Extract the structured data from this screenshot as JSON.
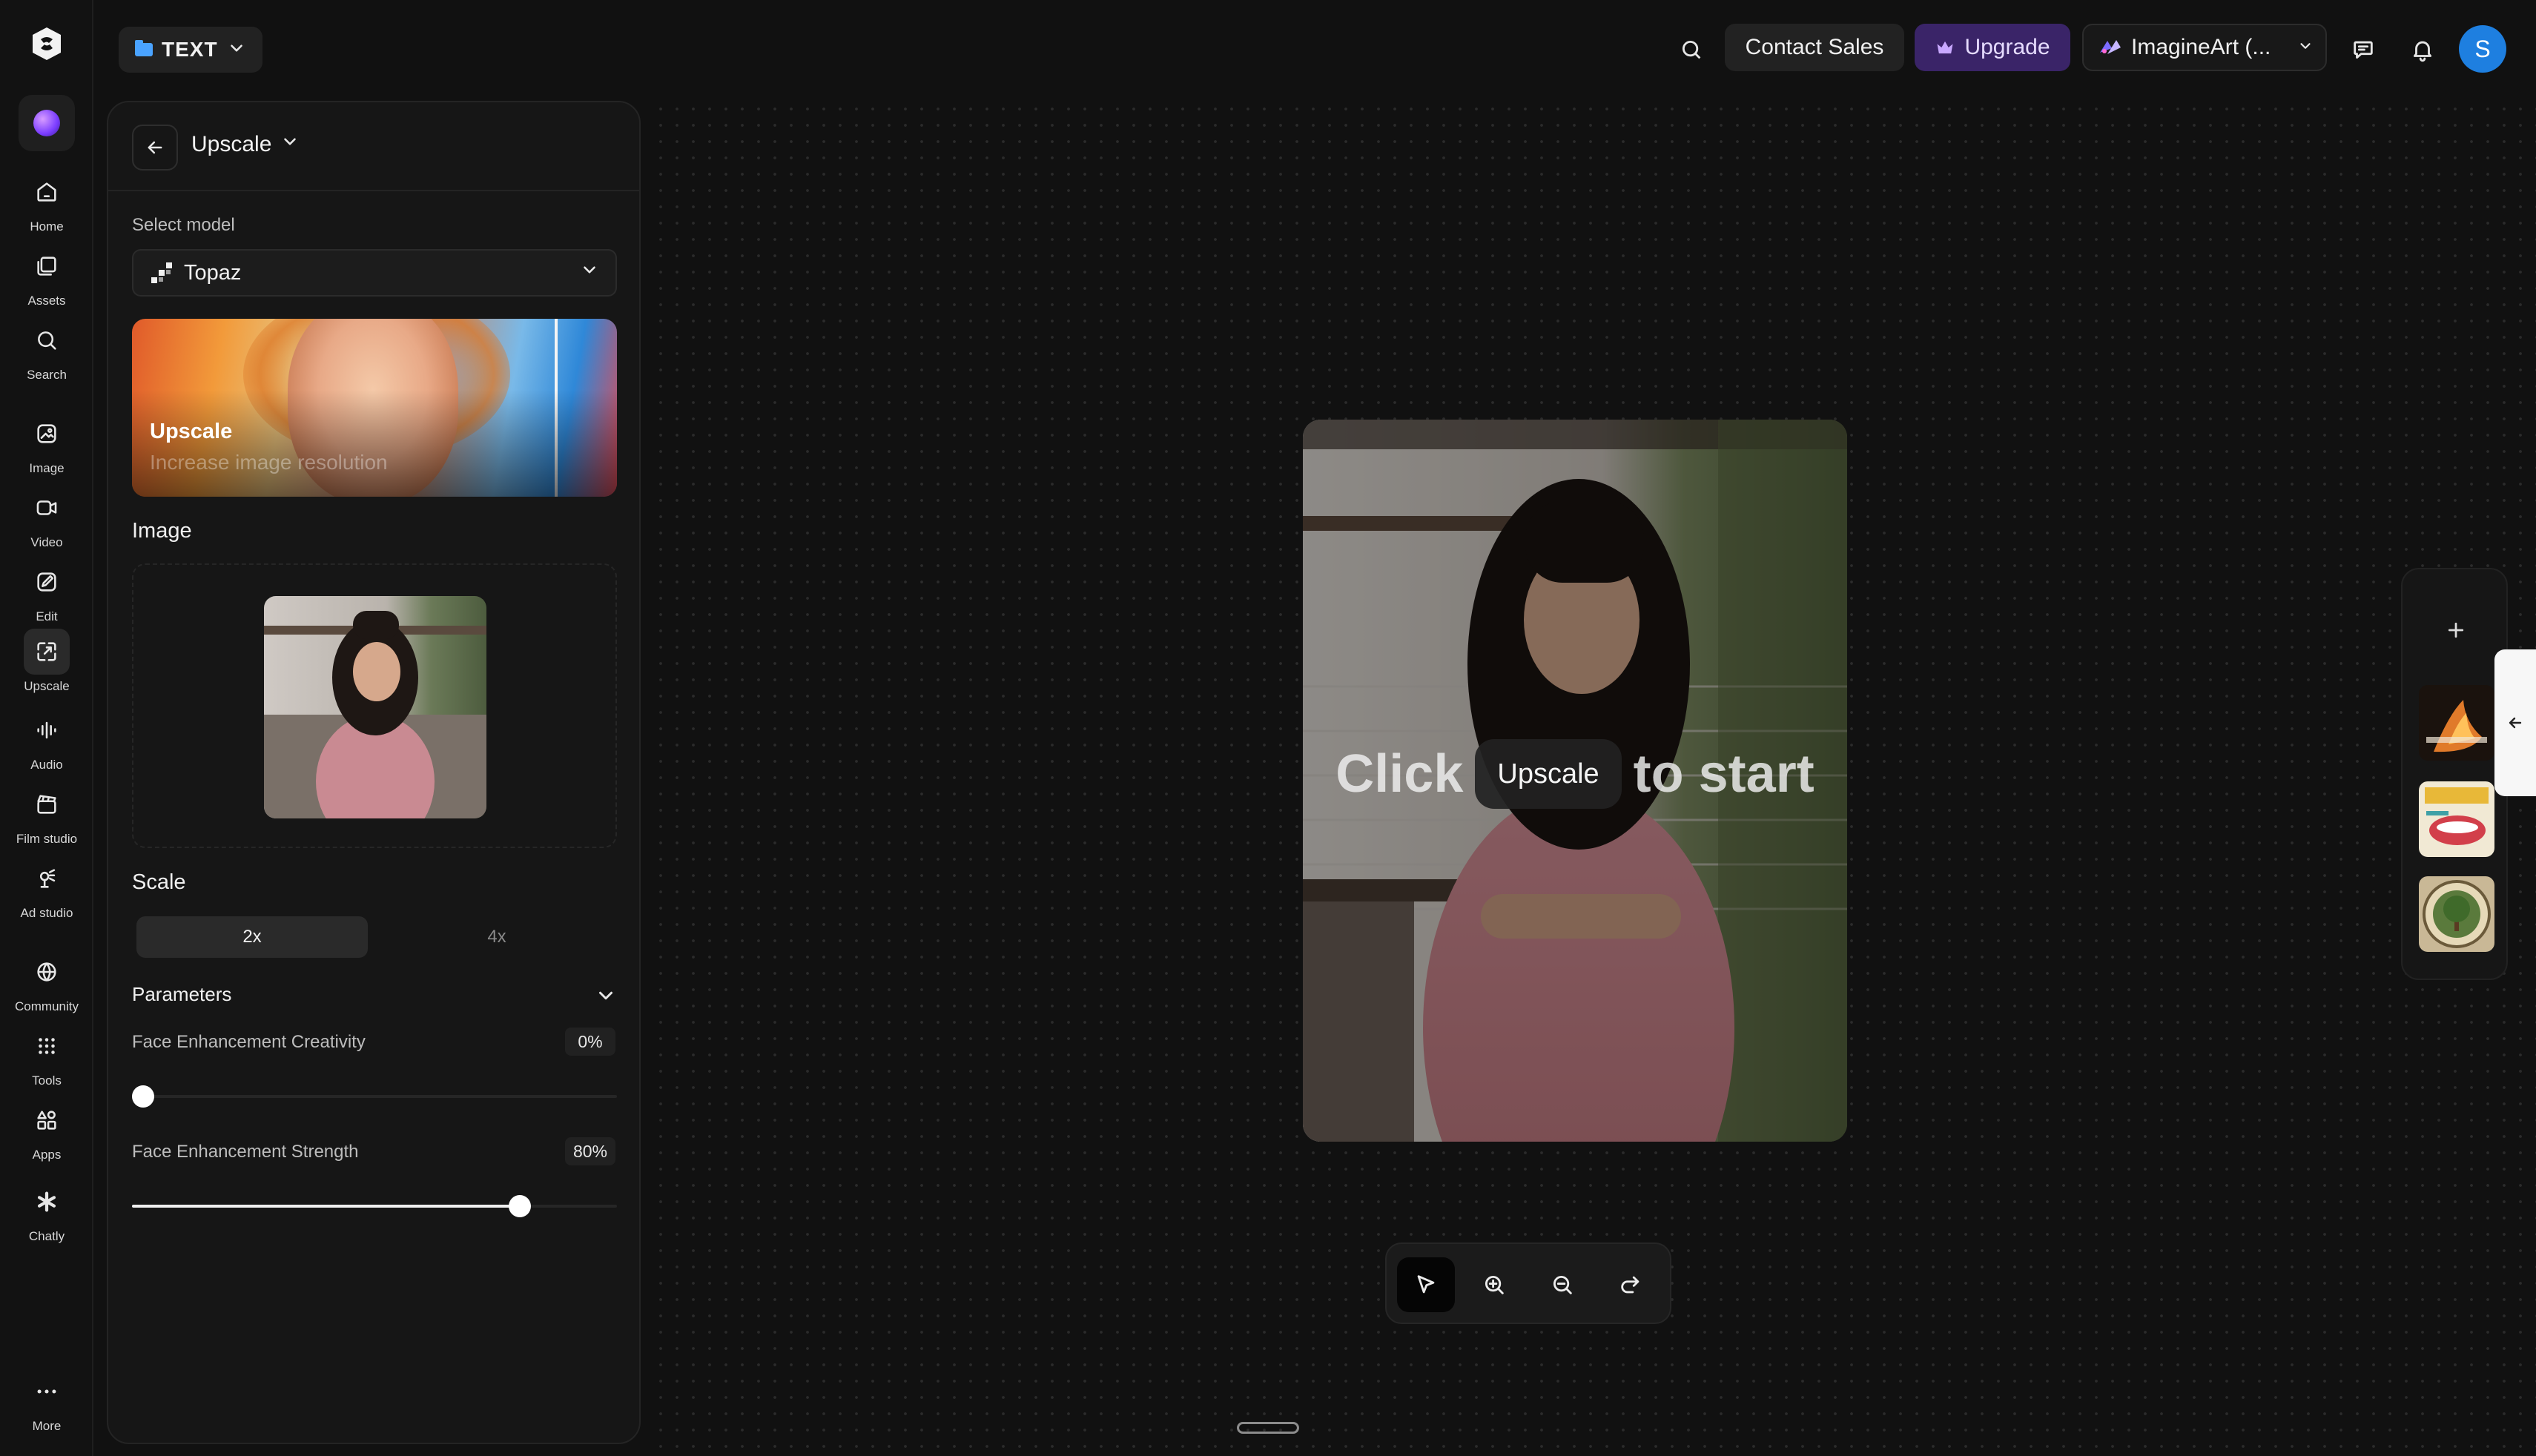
{
  "app": {
    "brand_color": "#ffffff",
    "accent": "#1e7fe0",
    "upgrade_color": "#3a2468"
  },
  "rail": {
    "items": [
      {
        "label": "Home",
        "icon": "home-icon"
      },
      {
        "label": "Assets",
        "icon": "assets-icon"
      },
      {
        "label": "Search",
        "icon": "search-icon"
      },
      {
        "label": "Image",
        "icon": "image-icon"
      },
      {
        "label": "Video",
        "icon": "video-icon"
      },
      {
        "label": "Edit",
        "icon": "edit-icon"
      },
      {
        "label": "Upscale",
        "icon": "upscale-icon",
        "active": true
      },
      {
        "label": "Audio",
        "icon": "audio-icon"
      },
      {
        "label": "Film studio",
        "icon": "film-studio-icon"
      },
      {
        "label": "Ad studio",
        "icon": "ad-studio-icon"
      },
      {
        "label": "Community",
        "icon": "globe-icon"
      },
      {
        "label": "Tools",
        "icon": "grid-icon"
      },
      {
        "label": "Apps",
        "icon": "apps-icon"
      },
      {
        "label": "Chatly",
        "icon": "chatly-icon"
      },
      {
        "label": "More",
        "icon": "more-icon"
      }
    ]
  },
  "topbar": {
    "project_label": "TEXT",
    "contact_label": "Contact Sales",
    "upgrade_label": "Upgrade",
    "workspace_label": "ImagineArt (...",
    "user_initial": "S"
  },
  "panel": {
    "title": "Upscale",
    "select_model_label": "Select model",
    "model_name": "Topaz",
    "banner_title": "Upscale",
    "banner_subtitle": "Increase image resolution",
    "image_label": "Image",
    "scale_label": "Scale",
    "scale_options": [
      "2x",
      "4x"
    ],
    "scale_selected": "2x",
    "parameters_label": "Parameters",
    "sliders": [
      {
        "label": "Face Enhancement Creativity",
        "value_text": "0%",
        "value": 0
      },
      {
        "label": "Face Enhancement Strength",
        "value_text": "80%",
        "value": 80
      }
    ]
  },
  "canvas": {
    "cta_before": "Click",
    "cta_button": "Upscale",
    "cta_after": "to start",
    "tools": [
      "select-tool",
      "zoom-in",
      "zoom-out",
      "redo"
    ]
  }
}
